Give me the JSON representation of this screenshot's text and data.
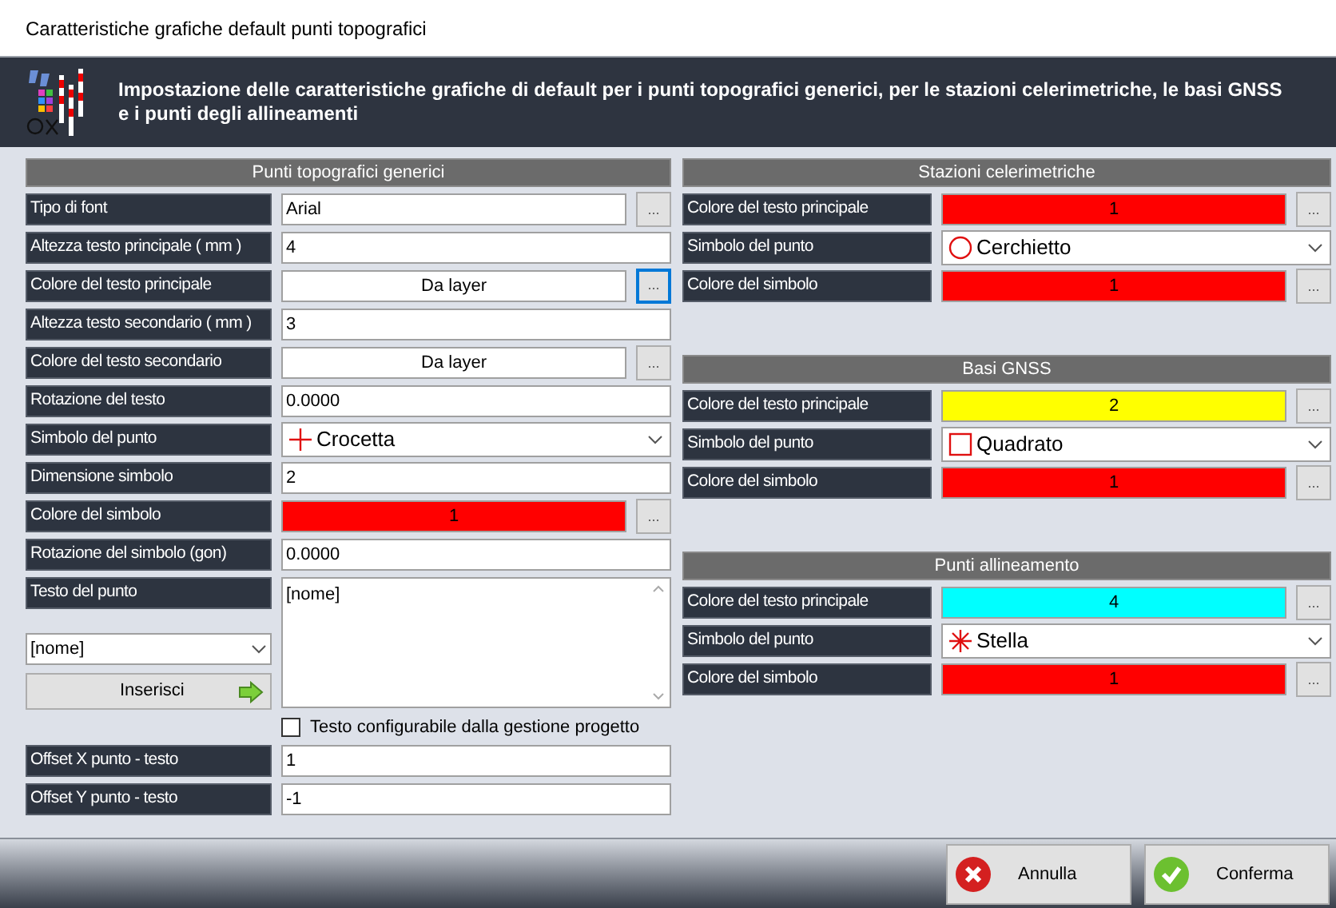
{
  "window": {
    "title": "Caratteristiche grafiche default punti topografici"
  },
  "header": {
    "text": "Impostazione delle caratteristiche grafiche di default per i punti topografici generici, per le stazioni celerimetriche, le basi GNSS e i punti degli allineamenti"
  },
  "general": {
    "title": "Punti topografici generici",
    "rows": [
      {
        "kind": "text",
        "label": "Tipo di font",
        "value": "Arial",
        "button": "...",
        "button_focused": false
      },
      {
        "kind": "text",
        "label": "Altezza testo principale ( mm )",
        "value": "4"
      },
      {
        "kind": "color",
        "label": "Colore del testo principale",
        "value": "Da layer",
        "color": "#ffffff",
        "button": "...",
        "button_focused": true
      },
      {
        "kind": "text",
        "label": "Altezza testo secondario ( mm )",
        "value": "3"
      },
      {
        "kind": "color",
        "label": "Colore del testo secondario",
        "value": "Da layer",
        "color": "#ffffff",
        "button": "...",
        "button_focused": false
      },
      {
        "kind": "text",
        "label": "Rotazione del testo",
        "value": "0.0000"
      },
      {
        "kind": "select",
        "label": "Simbolo del punto",
        "value": "Crocetta",
        "symbol": {
          "kind": "cross"
        }
      },
      {
        "kind": "text",
        "label": "Dimensione simbolo",
        "value": "2"
      },
      {
        "kind": "color",
        "label": "Colore del simbolo",
        "value": "1",
        "color": "#ff0000",
        "button": "...",
        "button_focused": false
      },
      {
        "kind": "text",
        "label": "Rotazione del simbolo (gon)",
        "value": "0.0000"
      }
    ],
    "point_text": {
      "label": "Testo del punto",
      "dropdown": "[nome]",
      "insert_button": "Inserisci",
      "text": "[nome]",
      "checkbox": {
        "label": "Testo configurabile dalla gestione progetto",
        "checked": false
      }
    },
    "offset_rows": [
      {
        "kind": "text",
        "label": "Offset X punto - testo",
        "value": "1"
      },
      {
        "kind": "text",
        "label": "Offset Y punto - testo",
        "value": "-1"
      }
    ]
  },
  "sections": [
    {
      "title": "Stazioni celerimetriche",
      "rows": [
        {
          "kind": "color",
          "label": "Colore del testo principale",
          "value": "1",
          "color": "#ff0000",
          "button": "...",
          "button_focused": false
        },
        {
          "kind": "select",
          "label": "Simbolo del punto",
          "value": "Cerchietto",
          "symbol": {
            "kind": "circle"
          }
        },
        {
          "kind": "color",
          "label": "Colore del simbolo",
          "value": "1",
          "color": "#ff0000",
          "button": "...",
          "button_focused": false
        }
      ]
    },
    {
      "title": "Basi GNSS",
      "rows": [
        {
          "kind": "color",
          "label": "Colore del testo principale",
          "value": "2",
          "color": "#ffff00",
          "button": "...",
          "button_focused": false
        },
        {
          "kind": "select",
          "label": "Simbolo del punto",
          "value": "Quadrato",
          "symbol": {
            "kind": "square"
          }
        },
        {
          "kind": "color",
          "label": "Colore del simbolo",
          "value": "1",
          "color": "#ff0000",
          "button": "...",
          "button_focused": false
        }
      ]
    },
    {
      "title": "Punti allineamento",
      "rows": [
        {
          "kind": "color",
          "label": "Colore del testo principale",
          "value": "4",
          "color": "#00ffff",
          "button": "...",
          "button_focused": false
        },
        {
          "kind": "select",
          "label": "Simbolo del punto",
          "value": "Stella",
          "symbol": {
            "kind": "star"
          }
        },
        {
          "kind": "color",
          "label": "Colore del simbolo",
          "value": "1",
          "color": "#ff0000",
          "button": "...",
          "button_focused": false
        }
      ]
    }
  ],
  "buttons": [
    {
      "kind": "cancel",
      "label": "Annulla"
    },
    {
      "kind": "confirm",
      "label": "Conferma"
    }
  ]
}
